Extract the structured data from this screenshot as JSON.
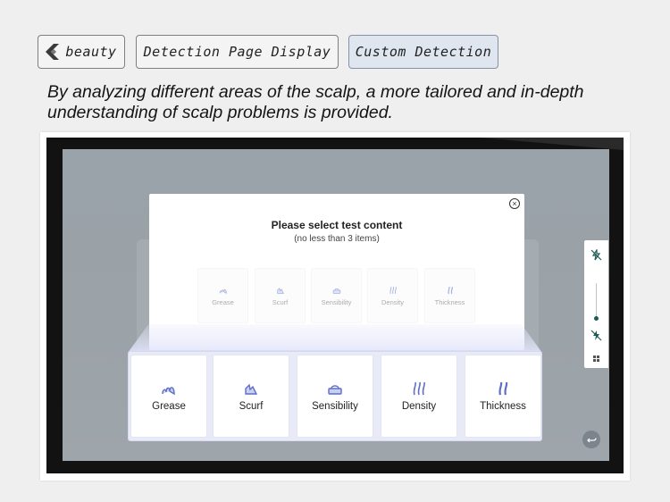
{
  "tags": {
    "brand": "beauty",
    "detection_page": "Detection Page Display",
    "custom_detection": "Custom Detection"
  },
  "caption": "By analyzing different areas of the scalp, a more tailored and in-depth understanding of scalp problems is provided.",
  "modal": {
    "title": "Please select test content",
    "subtitle": "(no less than 3 items)",
    "close_glyph": "×"
  },
  "items": [
    {
      "label": "Grease",
      "icon": "grease-icon"
    },
    {
      "label": "Scurf",
      "icon": "scurf-icon"
    },
    {
      "label": "Sensibility",
      "icon": "sensibility-icon"
    },
    {
      "label": "Density",
      "icon": "density-icon"
    },
    {
      "label": "Thickness",
      "icon": "thickness-icon"
    }
  ],
  "colors": {
    "accent": "#5d6fc8",
    "tray": "#e8eaf7",
    "toolbar_icon": "#1c5a55"
  }
}
